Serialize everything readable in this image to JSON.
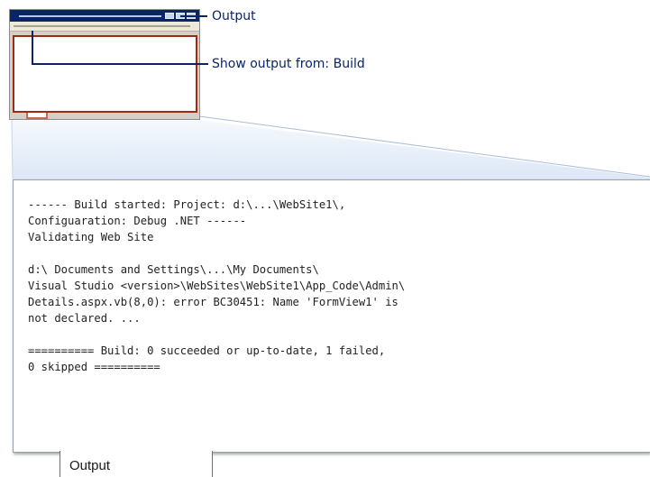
{
  "callouts": {
    "output_label": "Output",
    "show_output_from_label": "Show output from: Build"
  },
  "output_window": {
    "lines": [
      "------ Build started: Project: d:\\...\\WebSite1\\,",
      "Configuaration: Debug .NET ------",
      "Validating Web Site",
      "",
      "d:\\ Documents and Settings\\...\\My Documents\\",
      "Visual Studio <version>\\WebSites\\WebSite1\\App_Code\\Admin\\",
      "Details.aspx.vb(8,0): error BC30451: Name 'FormView1' is",
      "not declared. ...",
      "",
      "========== Build: 0 succeeded or up-to-date, 1 failed,",
      "0 skipped =========="
    ],
    "tab_label": "Output"
  },
  "colors": {
    "title_bar": "#0a246a",
    "callout_text": "#0a246a",
    "highlight_border": "#9b2b14",
    "funnel_fill": "#e6eef9"
  }
}
